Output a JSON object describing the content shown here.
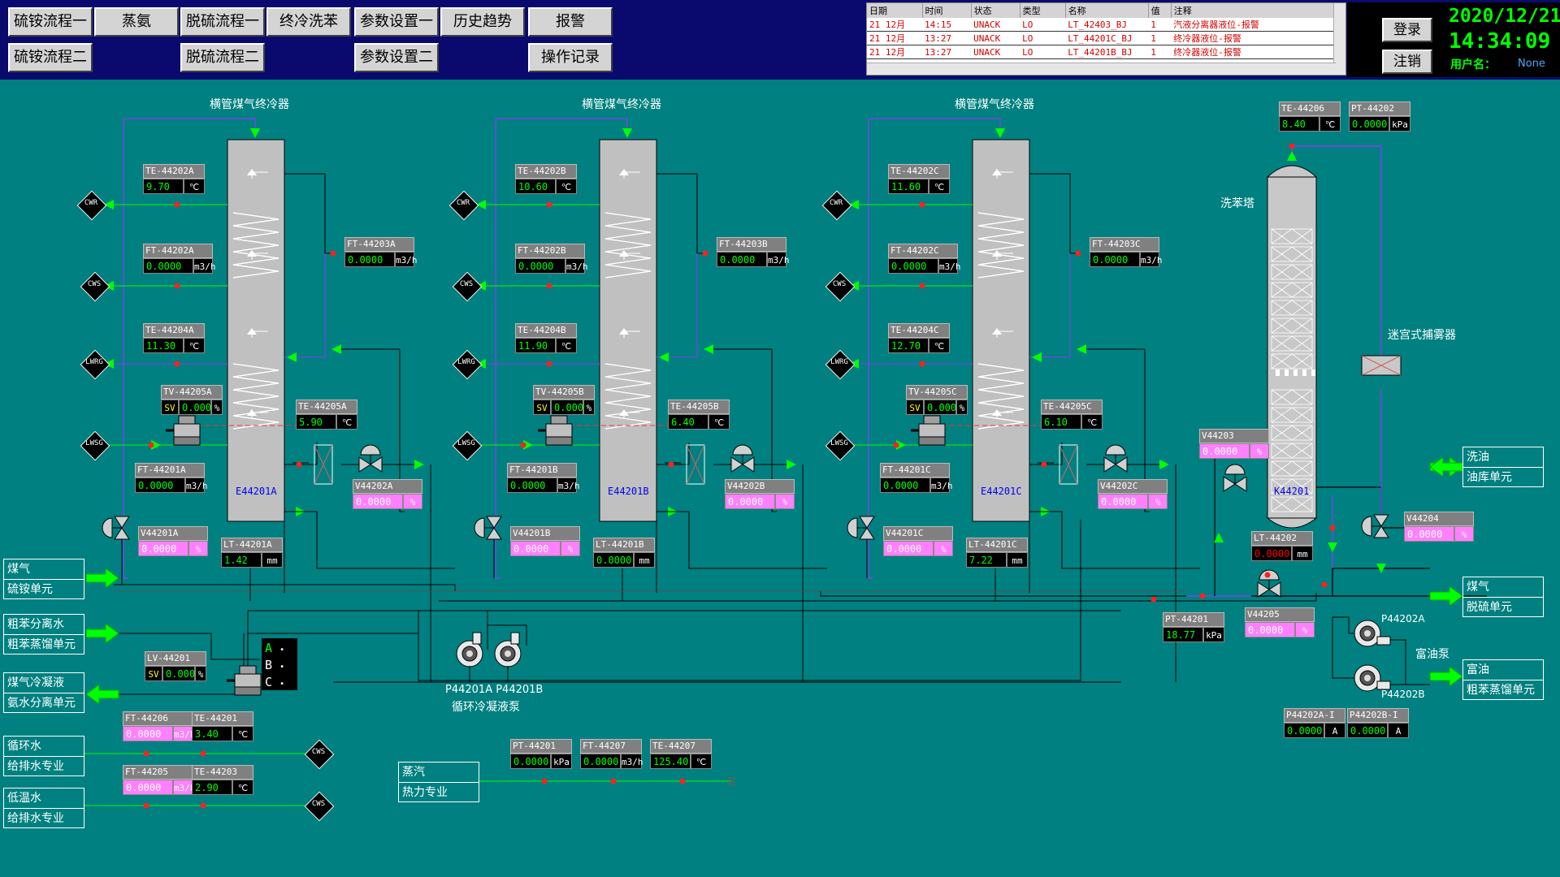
{
  "nav": {
    "row1": [
      "硫铵流程一",
      "蒸氨",
      "脱硫流程一",
      "终冷洗苯",
      "参数设置一",
      "历史趋势",
      "报警"
    ],
    "row2": [
      "硫铵流程二",
      "脱硫流程二",
      "参数设置二",
      "操作记录"
    ]
  },
  "alarm": {
    "headers": [
      "日期",
      "时间",
      "状态",
      "类型",
      "名称",
      "值",
      "注释"
    ],
    "rows": [
      [
        "21 12月",
        "14:15",
        "UNACK",
        "LO",
        "LT_42403_BJ",
        "1",
        "汽液分离器液位-报警"
      ],
      [
        "21 12月",
        "13:27",
        "UNACK",
        "LO",
        "LT_44201C_BJ",
        "1",
        "终冷器液位-报警"
      ],
      [
        "21 12月",
        "13:27",
        "UNACK",
        "LO",
        "LT_44201B_BJ",
        "1",
        "终冷器液位-报警"
      ]
    ]
  },
  "status": {
    "login": "登录",
    "logout": "注销",
    "date": "2020/12/21",
    "time": "14:34:09",
    "user_label": "用户名：",
    "user_value": "None"
  },
  "titles": {
    "coolerA": "横管煤气终冷器",
    "coolerB": "横管煤气终冷器",
    "coolerC": "横管煤气终冷器",
    "tower": "洗苯塔",
    "demister": "迷宫式捕雾器",
    "pump_names": "P44201A P44201B",
    "pump_desc": "循环冷凝液泵",
    "p44202a": "P44202A",
    "p44202b": "P44202B",
    "rich_pump": "富油泵"
  },
  "equip": {
    "eA": "E44201A",
    "eB": "E44201B",
    "eC": "E44201C",
    "k": "K44201",
    "abc": [
      "A",
      "B",
      "C"
    ]
  },
  "markers": {
    "cwr": "CWR",
    "cws": "CWS",
    "lwrg": "LWRG",
    "lwsg": "LWSG"
  },
  "boxes": {
    "meiqi_left": [
      "煤气",
      "硫铵单元"
    ],
    "cuben": [
      "粗苯分离水",
      "粗苯蒸馏单元"
    ],
    "lengning": [
      "煤气冷凝液",
      "氨水分离单元"
    ],
    "xunhuan": [
      "循环水",
      "给排水专业"
    ],
    "diwen": [
      "低温水",
      "给排水专业"
    ],
    "zhengqi": [
      "蒸汽",
      "热力专业"
    ],
    "xiyou": [
      "洗油",
      "油库单元"
    ],
    "meiqi_right": [
      "煤气",
      "脱硫单元"
    ],
    "fuyou": [
      "富油",
      "粗苯蒸馏单元"
    ]
  },
  "tags": {
    "te44202a": {
      "name": "TE-44202A",
      "value": "9.70",
      "unit": "℃"
    },
    "ft44202a": {
      "name": "FT-44202A",
      "value": "0.0000",
      "unit": "m3/h"
    },
    "te44204a": {
      "name": "TE-44204A",
      "value": "11.30",
      "unit": "℃"
    },
    "tv44205a": {
      "name": "TV-44205A",
      "sv": "SV",
      "value": "0.0000",
      "unit": "%"
    },
    "ft44201a": {
      "name": "FT-44201A",
      "value": "0.0000",
      "unit": "m3/h"
    },
    "te44205a": {
      "name": "TE-44205A",
      "value": "5.90",
      "unit": "℃"
    },
    "ft44203a": {
      "name": "FT-44203A",
      "value": "0.0000",
      "unit": "m3/h"
    },
    "v44202a": {
      "name": "V44202A",
      "value": "0.0000",
      "unit": "%"
    },
    "v44201a": {
      "name": "V44201A",
      "value": "0.0000",
      "unit": "%"
    },
    "lt44201a": {
      "name": "LT-44201A",
      "value": "1.42",
      "unit": "mm"
    },
    "te44202b": {
      "name": "TE-44202B",
      "value": "10.60",
      "unit": "℃"
    },
    "ft44202b": {
      "name": "FT-44202B",
      "value": "0.0000",
      "unit": "m3/h"
    },
    "te44204b": {
      "name": "TE-44204B",
      "value": "11.90",
      "unit": "℃"
    },
    "tv44205b": {
      "name": "TV-44205B",
      "sv": "SV",
      "value": "0.0000",
      "unit": "%"
    },
    "ft44201b": {
      "name": "FT-44201B",
      "value": "0.0000",
      "unit": "m3/h"
    },
    "te44205b": {
      "name": "TE-44205B",
      "value": "6.40",
      "unit": "℃"
    },
    "ft44203b": {
      "name": "FT-44203B",
      "value": "0.0000",
      "unit": "m3/h"
    },
    "v44202b": {
      "name": "V44202B",
      "value": "0.0000",
      "unit": "%"
    },
    "v44201b": {
      "name": "V44201B",
      "value": "0.0000",
      "unit": "%"
    },
    "lt44201b": {
      "name": "LT-44201B",
      "value": "0.0000",
      "unit": "mm"
    },
    "te44202c": {
      "name": "TE-44202C",
      "value": "11.60",
      "unit": "℃"
    },
    "ft44202c": {
      "name": "FT-44202C",
      "value": "0.0000",
      "unit": "m3/h"
    },
    "te44204c": {
      "name": "TE-44204C",
      "value": "12.70",
      "unit": "℃"
    },
    "tv44205c": {
      "name": "TV-44205C",
      "sv": "SV",
      "value": "0.0000",
      "unit": "%"
    },
    "ft44201c": {
      "name": "FT-44201C",
      "value": "0.0000",
      "unit": "m3/h"
    },
    "te44205c": {
      "name": "TE-44205C",
      "value": "6.10",
      "unit": "℃"
    },
    "ft44203c": {
      "name": "FT-44203C",
      "value": "0.0000",
      "unit": "m3/h"
    },
    "v44202c": {
      "name": "V44202C",
      "value": "0.0000",
      "unit": "%"
    },
    "v44201c": {
      "name": "V44201C",
      "value": "0.0000",
      "unit": "%"
    },
    "lt44201c": {
      "name": "LT-44201C",
      "value": "7.22",
      "unit": "mm"
    },
    "te44206": {
      "name": "TE-44206",
      "value": "8.40",
      "unit": "℃"
    },
    "pt44202": {
      "name": "PT-44202",
      "value": "0.0000",
      "unit": "kPa"
    },
    "v44203": {
      "name": "V44203",
      "value": "0.0000",
      "unit": "%"
    },
    "v44204": {
      "name": "V44204",
      "value": "0.0000",
      "unit": "%"
    },
    "lt44202": {
      "name": "LT-44202",
      "value": "0.0000",
      "unit": "mm"
    },
    "v44205": {
      "name": "V44205",
      "value": "0.0000",
      "unit": "%"
    },
    "pt44201": {
      "name": "PT-44201",
      "value": "18.77",
      "unit": "kPa"
    },
    "p44202ai": {
      "name": "P44202A-I",
      "value": "0.0000",
      "unit": "A"
    },
    "p44202bi": {
      "name": "P44202B-I",
      "value": "0.0000",
      "unit": "A"
    },
    "lv44201": {
      "name": "LV-44201",
      "sv": "SV",
      "value": "0.0000",
      "unit": "%"
    },
    "ft44206": {
      "name": "FT-44206",
      "value": "0.0000",
      "unit": "m3/h"
    },
    "te44201": {
      "name": "TE-44201",
      "value": "3.40",
      "unit": "℃"
    },
    "ft44205": {
      "name": "FT-44205",
      "value": "0.0000",
      "unit": "m3/h"
    },
    "te44203": {
      "name": "TE-44203",
      "value": "2.90",
      "unit": "℃"
    },
    "pt44201s": {
      "name": "PT-44201",
      "value": "0.0000",
      "unit": "kPa"
    },
    "ft44207": {
      "name": "FT-44207",
      "value": "0.0000",
      "unit": "m3/h"
    },
    "te44207": {
      "name": "TE-44207",
      "value": "125.40",
      "unit": "℃"
    }
  }
}
